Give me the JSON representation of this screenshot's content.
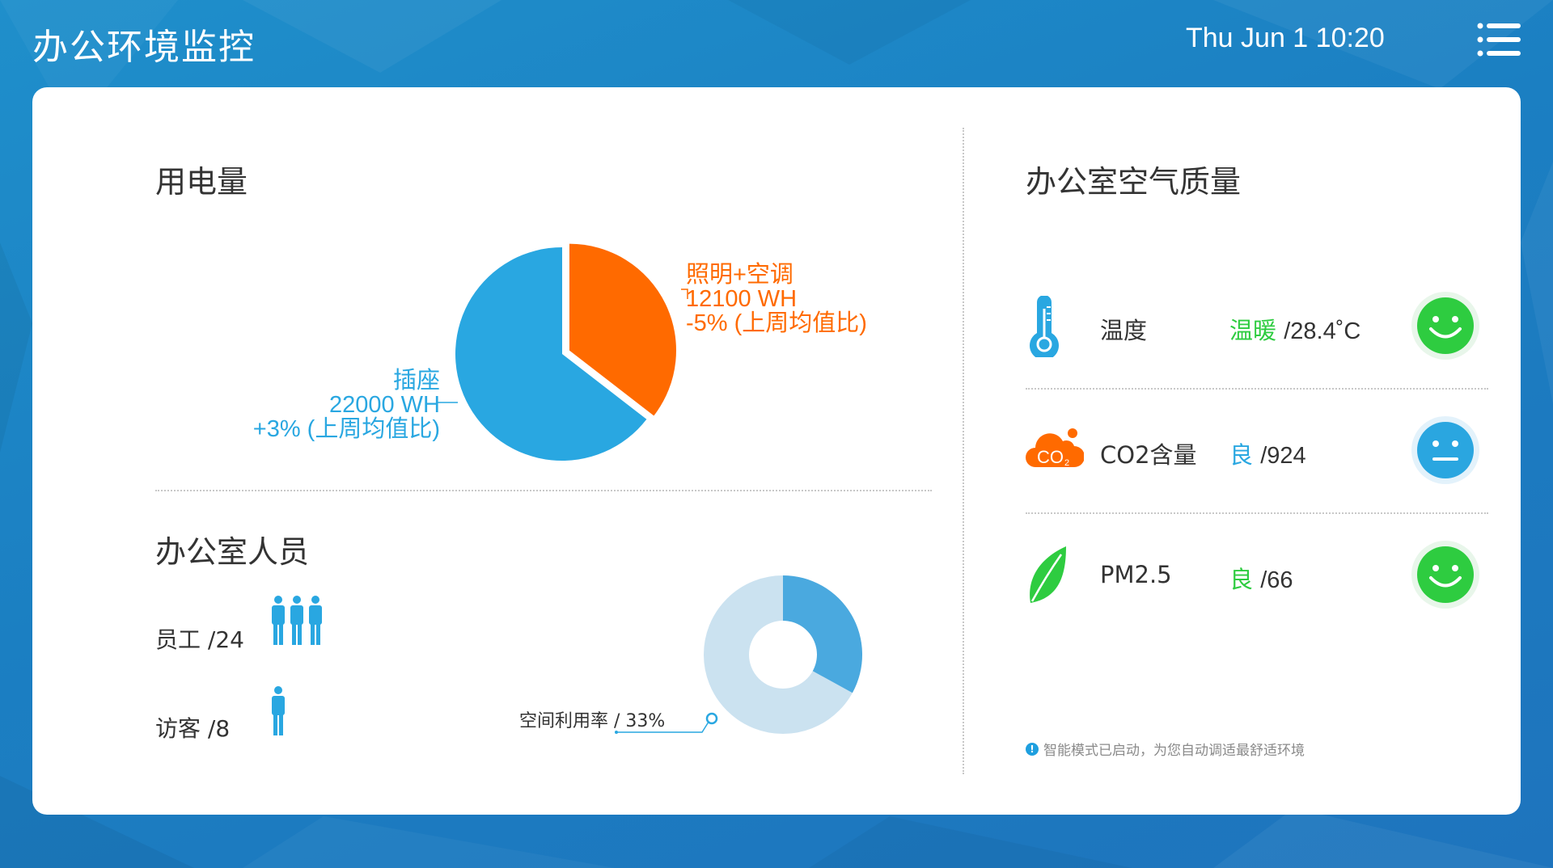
{
  "header": {
    "title": "办公环境监控",
    "datetime": "Thu Jun 1 10:20",
    "menu_icon": "list-menu-icon"
  },
  "electricity": {
    "title": "用电量",
    "segments": [
      {
        "name": "照明+空调",
        "value_text": "12100 WH",
        "change_text": "-5% (上周均值比)",
        "value": 12100,
        "color": "#ff6a00"
      },
      {
        "name": "插座",
        "value_text": "22000 WH",
        "change_text": "+3% (上周均值比)",
        "value": 22000,
        "color": "#29a7e1"
      }
    ]
  },
  "personnel": {
    "title": "办公室人员",
    "staff_label": "员工 /24",
    "visitor_label": "访客 /8",
    "utilization_label": "空间利用率 / 33%",
    "utilization": 0.33,
    "colors": {
      "fill": "#4aa9df",
      "track": "#cbe2f0",
      "icon": "#29a7e1"
    }
  },
  "air_quality": {
    "title": "办公室空气质量",
    "items": [
      {
        "name": "温度",
        "status": "温暖",
        "value": "/28.4˚C",
        "status_color": "#2ecc40",
        "icon": "thermometer-icon",
        "face": "smile-face-icon",
        "face_color": "#2ecc40"
      },
      {
        "name": "CO2含量",
        "status": "良",
        "value": "/924",
        "status_color": "#29a7e1",
        "icon": "co2-cloud-icon",
        "face": "neutral-face-icon",
        "face_color": "#2aa6e0"
      },
      {
        "name": "PM2.5",
        "status": "良",
        "value": "/66",
        "status_color": "#2ecc40",
        "icon": "leaf-icon",
        "face": "smile-face-icon",
        "face_color": "#2ecc40"
      }
    ],
    "notice": "智能模式已启动，为您自动调适最舒适环境"
  }
}
